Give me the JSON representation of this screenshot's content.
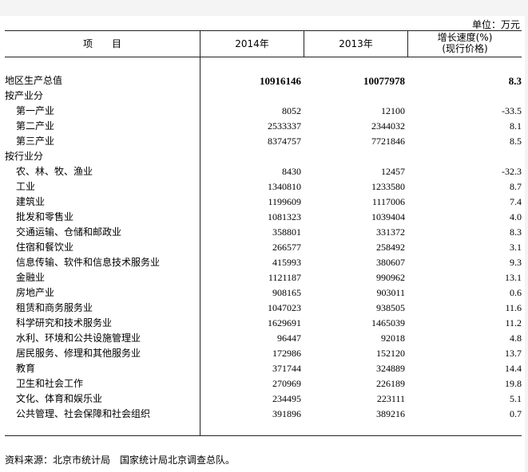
{
  "unit_label": "单位：万元",
  "header": {
    "item": "项　　目",
    "col_2014": "2014年",
    "col_2013": "2013年",
    "growth_line1": "增长速度(%)",
    "growth_line2": "(现行价格)"
  },
  "rows": [
    {
      "label": "地区生产总值",
      "v2014": "10916146",
      "v2013": "10077978",
      "growth": "8.3"
    },
    {
      "label": "按产业分",
      "v2014": "",
      "v2013": "",
      "growth": ""
    },
    {
      "label": "第一产业",
      "v2014": "8052",
      "v2013": "12100",
      "growth": "-33.5"
    },
    {
      "label": "第二产业",
      "v2014": "2533337",
      "v2013": "2344032",
      "growth": "8.1"
    },
    {
      "label": "第三产业",
      "v2014": "8374757",
      "v2013": "7721846",
      "growth": "8.5"
    },
    {
      "label": "按行业分",
      "v2014": "",
      "v2013": "",
      "growth": ""
    },
    {
      "label": "农、林、牧、渔业",
      "v2014": "8430",
      "v2013": "12457",
      "growth": "-32.3"
    },
    {
      "label": "工业",
      "v2014": "1340810",
      "v2013": "1233580",
      "growth": "8.7"
    },
    {
      "label": "建筑业",
      "v2014": "1199609",
      "v2013": "1117006",
      "growth": "7.4"
    },
    {
      "label": "批发和零售业",
      "v2014": "1081323",
      "v2013": "1039404",
      "growth": "4.0"
    },
    {
      "label": "交通运输、仓储和邮政业",
      "v2014": "358801",
      "v2013": "331372",
      "growth": "8.3"
    },
    {
      "label": "住宿和餐饮业",
      "v2014": "266577",
      "v2013": "258492",
      "growth": "3.1"
    },
    {
      "label": "信息传输、软件和信息技术服务业",
      "v2014": "415993",
      "v2013": "380607",
      "growth": "9.3"
    },
    {
      "label": "金融业",
      "v2014": "1121187",
      "v2013": "990962",
      "growth": "13.1"
    },
    {
      "label": "房地产业",
      "v2014": "908165",
      "v2013": "903011",
      "growth": "0.6"
    },
    {
      "label": "租赁和商务服务业",
      "v2014": "1047023",
      "v2013": "938505",
      "growth": "11.6"
    },
    {
      "label": "科学研究和技术服务业",
      "v2014": "1629691",
      "v2013": "1465039",
      "growth": "11.2"
    },
    {
      "label": "水利、环境和公共设施管理业",
      "v2014": "96447",
      "v2013": "92018",
      "growth": "4.8"
    },
    {
      "label": "居民服务、修理和其他服务业",
      "v2014": "172986",
      "v2013": "152120",
      "growth": "13.7"
    },
    {
      "label": "教育",
      "v2014": "371744",
      "v2013": "324889",
      "growth": "14.4"
    },
    {
      "label": "卫生和社会工作",
      "v2014": "270969",
      "v2013": "226189",
      "growth": "19.8"
    },
    {
      "label": "文化、体育和娱乐业",
      "v2014": "234495",
      "v2013": "223111",
      "growth": "5.1"
    },
    {
      "label": "公共管理、社会保障和社会组织",
      "v2014": "391896",
      "v2013": "389216",
      "growth": "0.7"
    }
  ],
  "source": "资料来源：北京市统计局　国家统计局北京调查总队。"
}
